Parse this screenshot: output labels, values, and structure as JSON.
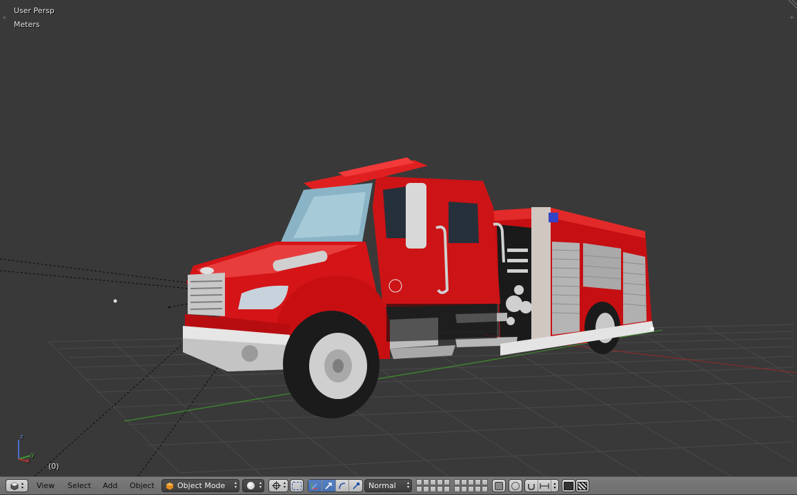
{
  "viewport": {
    "view_name": "User Persp",
    "units": "Meters",
    "frame": "(0)",
    "axis_labels": {
      "x": "x",
      "y": "y",
      "z": "z"
    }
  },
  "header": {
    "editor_type_icon": "cube-icon",
    "menus": {
      "view": "View",
      "select": "Select",
      "add": "Add",
      "object": "Object"
    },
    "mode": "Object Mode",
    "mode_icon": "cube-icon",
    "viewport_shading_icon": "sphere-icon",
    "pivot_icon": "pivot-center-icon",
    "manipulator_icons": [
      "manipulator-toggle-icon",
      "translate-icon",
      "rotate-icon",
      "scale-icon"
    ],
    "transform_orientation": "Normal",
    "colors": {
      "header_bg": "#727272",
      "viewport_bg": "#393939",
      "active_blue": "#5680c2",
      "grid_x": "#9a2a2a",
      "grid_y": "#3c8a2a",
      "truck_red": "#d21414"
    }
  }
}
